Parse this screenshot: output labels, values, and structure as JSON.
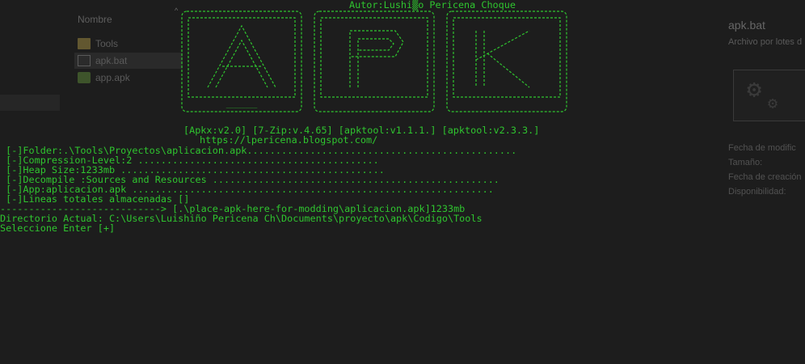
{
  "explorer": {
    "column_header": "Nombre",
    "files": [
      {
        "name": "Tools",
        "icon": "folder-icon"
      },
      {
        "name": "apk.bat",
        "icon": "batch-file-icon"
      },
      {
        "name": "app.apk",
        "icon": "apk-file-icon"
      }
    ],
    "details": {
      "title": "apk.bat",
      "subtitle": "Archivo por lotes d",
      "properties": [
        "Fecha de modific",
        "Tamaño:",
        "Fecha de creación",
        "Disponibilidad:"
      ]
    }
  },
  "console": {
    "author_line": "Autor:Lushi▒o Pericena Choque",
    "logo_text": "APK",
    "versions_line": "[Apkx:v2.0] [7-Zip:v.4.65] [apktool:v1.1.1.] [apktool:v2.3.3.]",
    "blog_line": "https://lpericena.blogspot.com/",
    "status_lines": [
      " [-]Folder:.\\Tools\\Proyectos\\aplicacion.apk...............................................",
      " [-]Compression-Level:2 ..........................................",
      " [-]Heap Size:1233mb ..............................................",
      " [-]Decompile :Sources and Resources ..................................................",
      " [-]App:aplicacion.apk ...............................................................",
      " [-]Lineas totales almacenadas []"
    ],
    "path_line": "----------------------------> [.\\place-apk-here-for-modding\\aplicacion.apk]1233mb",
    "directory_line": "Directorio Actual: C:\\Users\\Luishiño Pericena Ch\\Documents\\proyecto\\apk\\Codigo\\Tools",
    "prompt_line": "Seleccione Enter [+]"
  },
  "colors": {
    "console_text": "#2fc52f",
    "background": "#1a1a1a"
  }
}
